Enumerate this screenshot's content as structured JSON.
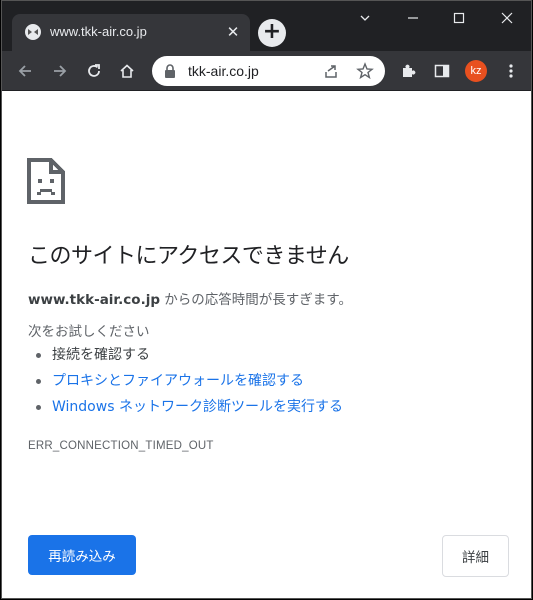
{
  "tab": {
    "title": "www.tkk-air.co.jp",
    "close": "✕",
    "new_tab": "+"
  },
  "toolbar": {
    "url": "tkk-air.co.jp",
    "avatar_initials": "kz"
  },
  "icons": {
    "back": "back-arrow-icon",
    "forward": "forward-arrow-icon",
    "reload": "reload-icon",
    "home": "home-icon",
    "lock": "lock-icon",
    "share": "share-icon",
    "bookmark": "star-icon",
    "extensions": "puzzle-icon",
    "sidepanel": "side-panel-icon",
    "menu": "kebab-menu-icon",
    "error": "sad-document-icon"
  },
  "colors": {
    "accent": "#1a73e8",
    "avatar": "#e8501f",
    "chrome_dark": "#35363a"
  },
  "error_page": {
    "heading": "このサイトにアクセスできません",
    "host": "www.tkk-air.co.jp",
    "message_rest": " からの応答時間が長すぎます。",
    "try_title": "次をお試しください",
    "suggestions": [
      {
        "text": "接続を確認する",
        "link": false
      },
      {
        "text": "プロキシとファイアウォールを確認する",
        "link": true
      },
      {
        "text": "Windows ネットワーク診断ツールを実行する",
        "link": true
      }
    ],
    "error_code": "ERR_CONNECTION_TIMED_OUT",
    "reload_label": "再読み込み",
    "details_label": "詳細"
  }
}
